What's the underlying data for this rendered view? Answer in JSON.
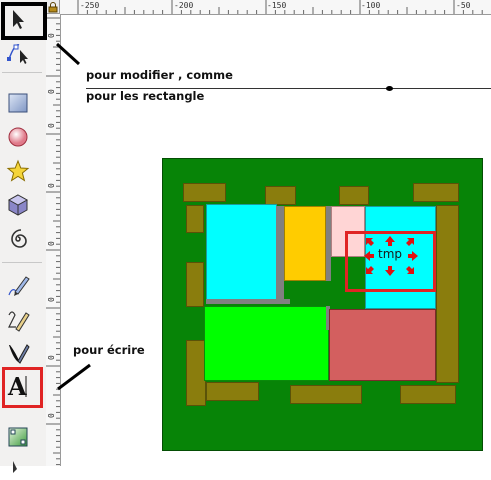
{
  "toolbox": {
    "tools": [
      {
        "name": "selector-tool",
        "icon": "arrow-cursor-icon"
      },
      {
        "name": "node-editor-tool",
        "icon": "node-arrow-icon"
      },
      {
        "name": "rectangle-tool",
        "icon": "rectangle-icon"
      },
      {
        "name": "ellipse-tool",
        "icon": "circle-icon"
      },
      {
        "name": "star-tool",
        "icon": "star-icon"
      },
      {
        "name": "3d-box-tool",
        "icon": "cube-icon"
      },
      {
        "name": "spiral-tool",
        "icon": "spiral-icon"
      },
      {
        "name": "pencil-tool",
        "icon": "pencil-icon"
      },
      {
        "name": "pen-tool",
        "icon": "pen-icon"
      },
      {
        "name": "calligraphy-tool",
        "icon": "calligraphy-icon"
      },
      {
        "name": "text-tool",
        "icon": "text-a-icon"
      },
      {
        "name": "gradient-tool",
        "icon": "gradient-icon"
      }
    ]
  },
  "ruler": {
    "h_labels": [
      "-250",
      "-200",
      "-150",
      "-100",
      "-50"
    ],
    "v_labels": [
      "0",
      "0",
      "0",
      "0",
      "0",
      "0",
      "0",
      "0"
    ]
  },
  "annotations": {
    "modify_line1": "pour modifier , comme",
    "modify_line2": "pour les rectangle",
    "write": "pour écrire"
  },
  "canvas": {
    "text_object": "tmp"
  },
  "colors": {
    "background_green": "#078407",
    "cyan": "#00ffff",
    "yellow": "#ffcc00",
    "pink": "#ffd5d5",
    "bright_green": "#00ff00",
    "salmon": "#d35f5f",
    "olive": "#8a7d0d",
    "highlight_red": "#e02424"
  }
}
